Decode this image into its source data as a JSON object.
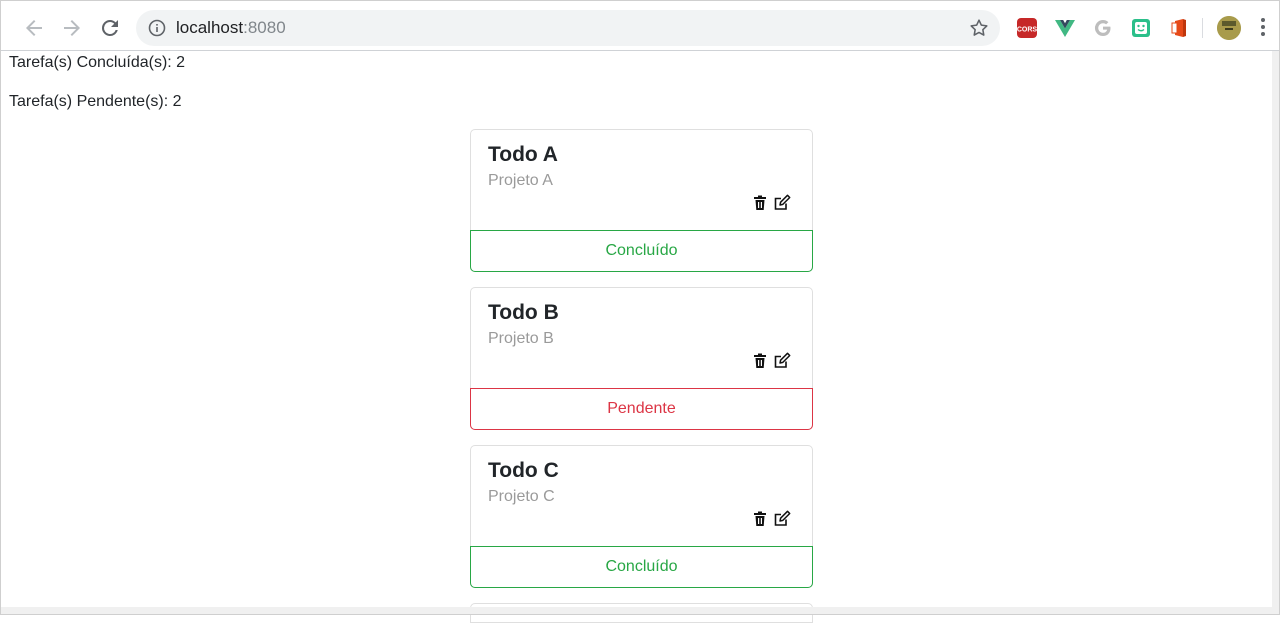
{
  "browser": {
    "url_host": "localhost",
    "url_port": ":8080",
    "extensions": [
      {
        "name": "CORS",
        "icon": "cors-icon",
        "color": "#c62828"
      },
      {
        "name": "Vue",
        "icon": "vue-icon",
        "color": "#41b883"
      },
      {
        "name": "Google",
        "icon": "google-icon",
        "color": "#bdbdbd"
      },
      {
        "name": "Extension",
        "icon": "smiley-extension-icon",
        "color": "#2bbf8a"
      },
      {
        "name": "Office",
        "icon": "office-icon",
        "color": "#e64a19"
      }
    ]
  },
  "summary": {
    "completed_label": "Tarefa(s) Concluída(s): 2",
    "pending_label": "Tarefa(s) Pendente(s): 2"
  },
  "todos": [
    {
      "title": "Todo A",
      "project": "Projeto A",
      "status": "Concluído",
      "status_color": "#28a745"
    },
    {
      "title": "Todo B",
      "project": "Projeto B",
      "status": "Pendente",
      "status_color": "#dc3545"
    },
    {
      "title": "Todo C",
      "project": "Projeto C",
      "status": "Concluído",
      "status_color": "#28a745"
    }
  ],
  "icons": {
    "delete": "trash-icon",
    "edit": "edit-icon"
  }
}
